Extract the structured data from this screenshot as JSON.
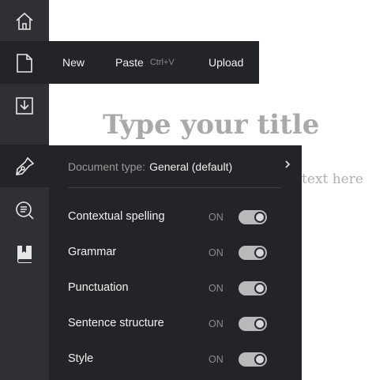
{
  "editor": {
    "title_placeholder": "Type your title",
    "body_placeholder_visible": "text here"
  },
  "rail": {
    "items": [
      {
        "icon": "home-icon"
      },
      {
        "icon": "new-document-icon",
        "active": true
      },
      {
        "icon": "download-icon"
      },
      {
        "icon": "pen-nib-icon",
        "active": true
      },
      {
        "icon": "search-document-icon"
      },
      {
        "icon": "book-icon"
      }
    ]
  },
  "file_menu": {
    "new_label": "New",
    "paste_label": "Paste",
    "paste_shortcut": "Ctrl+V",
    "upload_label": "Upload"
  },
  "settings": {
    "doc_type_label": "Document type:",
    "doc_type_value": "General (default)",
    "options": [
      {
        "label": "Contextual spelling",
        "state": "ON",
        "on": true
      },
      {
        "label": "Grammar",
        "state": "ON",
        "on": true
      },
      {
        "label": "Punctuation",
        "state": "ON",
        "on": true
      },
      {
        "label": "Sentence structure",
        "state": "ON",
        "on": true
      },
      {
        "label": "Style",
        "state": "ON",
        "on": true
      }
    ]
  },
  "colors": {
    "rail_bg": "#2f3033",
    "menu_bg": "#232427",
    "toggle_on": "#b9b9bc"
  }
}
